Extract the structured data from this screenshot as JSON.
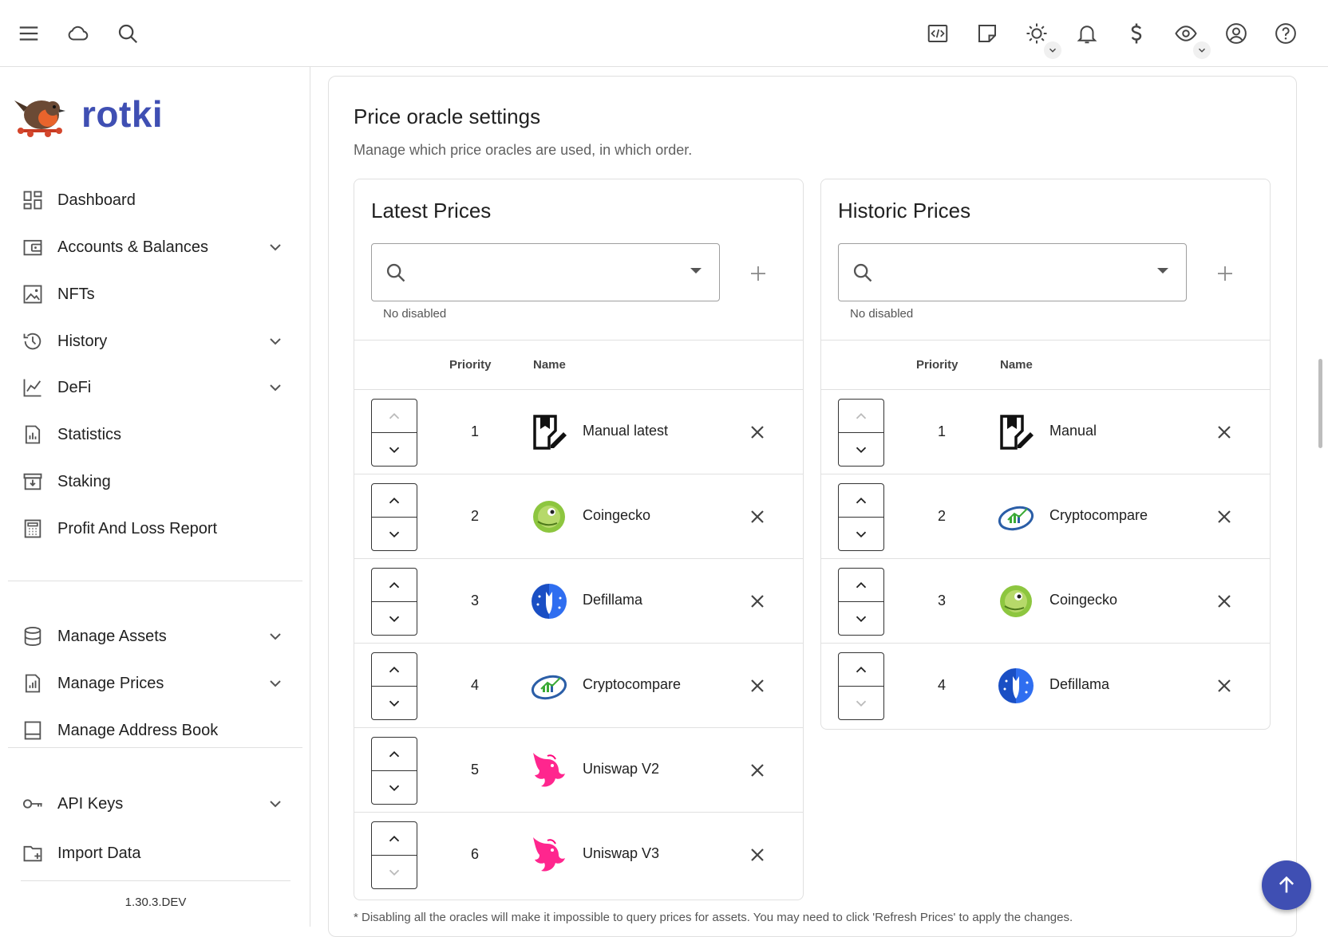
{
  "app": {
    "name": "rotki",
    "version": "1.30.3.DEV"
  },
  "topbar": {
    "icons": [
      "menu-icon",
      "cloud-icon",
      "search-icon",
      "code-icon",
      "notes-icon",
      "theme-icon",
      "bell-icon",
      "currency-icon",
      "privacy-icon",
      "account-icon",
      "help-icon"
    ]
  },
  "sidebar": {
    "items": [
      {
        "label": "Dashboard",
        "icon": "dashboard-icon",
        "expandable": false
      },
      {
        "label": "Accounts & Balances",
        "icon": "wallet-icon",
        "expandable": true
      },
      {
        "label": "NFTs",
        "icon": "image-icon",
        "expandable": false
      },
      {
        "label": "History",
        "icon": "history-icon",
        "expandable": true
      },
      {
        "label": "DeFi",
        "icon": "chart-line-icon",
        "expandable": true
      },
      {
        "label": "Statistics",
        "icon": "statistics-icon",
        "expandable": false
      },
      {
        "label": "Staking",
        "icon": "staking-icon",
        "expandable": false
      },
      {
        "label": "Profit And Loss Report",
        "icon": "calculator-icon",
        "expandable": false
      },
      {
        "label": "Manage Assets",
        "icon": "database-icon",
        "expandable": true
      },
      {
        "label": "Manage Prices",
        "icon": "price-chart-icon",
        "expandable": true
      },
      {
        "label": "Manage Address Book",
        "icon": "address-book-icon",
        "expandable": false
      },
      {
        "label": "API Keys",
        "icon": "key-icon",
        "expandable": true
      },
      {
        "label": "Import Data",
        "icon": "folder-import-icon",
        "expandable": false
      }
    ]
  },
  "main": {
    "title": "Price oracle settings",
    "subtitle": "Manage which price oracles are used, in which order.",
    "footnote": "* Disabling all the oracles will make it impossible to query prices for assets. You may need to click 'Refresh Prices' to apply the changes.",
    "columns": {
      "priority": "Priority",
      "name": "Name"
    },
    "latest": {
      "title": "Latest Prices",
      "hint": "No disabled",
      "rows": [
        {
          "priority": "1",
          "name": "Manual latest",
          "icon": "manual-icon"
        },
        {
          "priority": "2",
          "name": "Coingecko",
          "icon": "coingecko-icon"
        },
        {
          "priority": "3",
          "name": "Defillama",
          "icon": "defillama-icon"
        },
        {
          "priority": "4",
          "name": "Cryptocompare",
          "icon": "cryptocompare-icon"
        },
        {
          "priority": "5",
          "name": "Uniswap V2",
          "icon": "uniswap-icon"
        },
        {
          "priority": "6",
          "name": "Uniswap V3",
          "icon": "uniswap-icon"
        }
      ]
    },
    "historic": {
      "title": "Historic Prices",
      "hint": "No disabled",
      "rows": [
        {
          "priority": "1",
          "name": "Manual",
          "icon": "manual-icon"
        },
        {
          "priority": "2",
          "name": "Cryptocompare",
          "icon": "cryptocompare-icon"
        },
        {
          "priority": "3",
          "name": "Coingecko",
          "icon": "coingecko-icon"
        },
        {
          "priority": "4",
          "name": "Defillama",
          "icon": "defillama-icon"
        }
      ]
    }
  },
  "colors": {
    "brand": "#3f4fb3",
    "coingecko": "#8dc63f",
    "defillama": "#2f6ef0",
    "uniswap": "#ff007a",
    "cryptocompare": "#2b5ea7"
  }
}
